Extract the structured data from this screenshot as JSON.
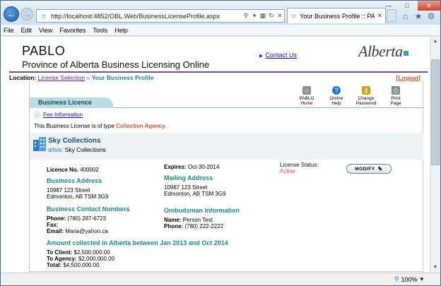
{
  "browser": {
    "url": "http://localhost:4852/OBL.Web/BusinessLicenseProfile.aspx",
    "tab_title": "Your Business Profile :: PAB...",
    "zoom": "100%",
    "menu": [
      "File",
      "Edit",
      "View",
      "Favorites",
      "Tools",
      "Help"
    ]
  },
  "header": {
    "brand": "PABLO",
    "subtitle": "Province of Alberta Business Licensing Online",
    "contact": "Contact Us",
    "logo": "Alberta"
  },
  "location": {
    "label": "Location:",
    "link": "License Selection",
    "separator": "»",
    "current": "Your Business Profile",
    "logout": "Logout"
  },
  "toolbar": [
    {
      "label1": "PABLO",
      "label2": "Home",
      "icon": "home-icon",
      "color": "#8a8f9a"
    },
    {
      "label1": "Online",
      "label2": "Help",
      "icon": "help-icon",
      "color": "#2a72c4"
    },
    {
      "label1": "Change",
      "label2": "Password",
      "icon": "key-icon",
      "color": "#d6a21e"
    },
    {
      "label1": "Print",
      "label2": "Page",
      "icon": "print-icon",
      "color": "#7b8794"
    }
  ],
  "licence": {
    "tab": "Business Licence",
    "fee_link": "Fee Information",
    "type_prefix": "This Business License is of type",
    "type_value": "Collection Agency",
    "type_suffix": ".",
    "business_name": "Sky Collections",
    "dba_label": "d/b/a:",
    "dba_value": "Sky Collections",
    "licence_no_label": "Licence No.",
    "licence_no": "400002",
    "expires_label": "Expires:",
    "expires": "Oct-30-2014",
    "status_label": "License Status:",
    "status": "Active",
    "modify": "MODIFY",
    "business_address_title": "Business Address",
    "business_address_1": "10987 123 Street",
    "business_address_2": "Edmonton, AB TSM 3G9",
    "mailing_address_title": "Mailing Address",
    "mailing_address_1": "10987 123 Street",
    "mailing_address_2": "Edmonton, AB TSM 3G9",
    "contact_title": "Business Contact Numbers",
    "phone_label": "Phone:",
    "phone": "(780) 287-6723",
    "fax_label": "Fax:",
    "fax": "",
    "email_label": "Email:",
    "email": "Maria@yahoo.ca",
    "ombudsman_title": "Ombudsman Information",
    "omb_name_label": "Name:",
    "omb_name": "Person Test",
    "omb_phone_label": "Phone:",
    "omb_phone": "(780) 222-2222",
    "amount_title": "Amount collected in Alberta between Jan 2013 and Oct 2014",
    "to_client_label": "To Client:",
    "to_client": "$2,500,000.00",
    "to_agency_label": "To Agency:",
    "to_agency": "$2,000,000.00",
    "total_label": "Total:",
    "total": "$4,500,000.00"
  }
}
